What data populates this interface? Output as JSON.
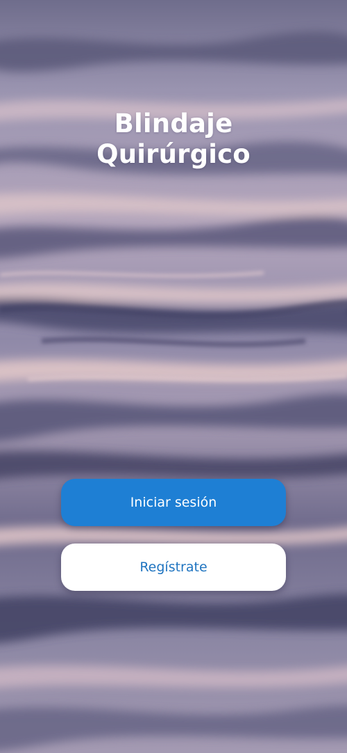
{
  "app": {
    "title_line1": "Blindaje",
    "title_line2": "Quirúrgico"
  },
  "actions": {
    "login_label": "Iniciar sesión",
    "register_label": "Regístrate"
  },
  "colors": {
    "primary_button": "#1e7fd4",
    "secondary_button": "#ffffff",
    "secondary_text": "#1f74c0",
    "title_text": "#ffffff"
  },
  "background": {
    "description_icon": "water-waves-image"
  }
}
